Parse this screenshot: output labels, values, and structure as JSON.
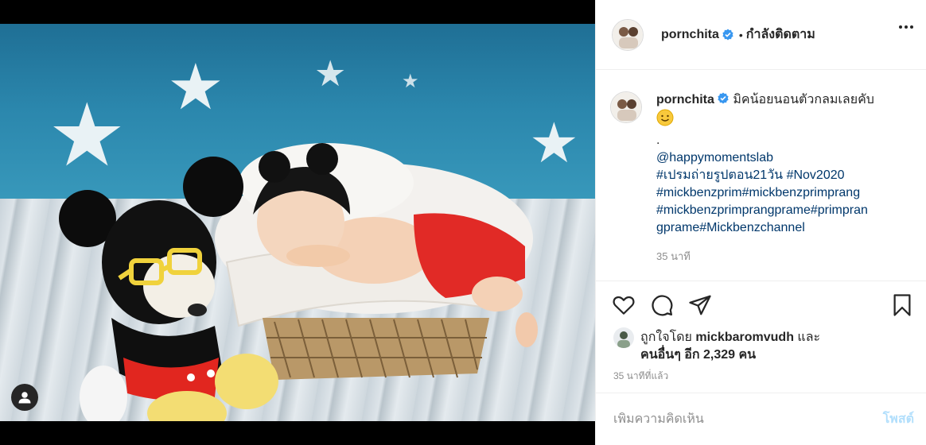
{
  "post": {
    "username": "pornchita",
    "follow_status": "กำลังติดตาม",
    "caption": {
      "username": "pornchita",
      "text": "มิคน้อยนอนตัวกลมเลยคับ",
      "emoji": "😊",
      "dot_line": ".",
      "mention": "@happymomentslab",
      "hashtag_line1": "#เปรมถ่ายรูปตอน21วัน #Nov2020",
      "hashtag_line2": "#mickbenzprim#mickbenzprimprang",
      "hashtag_line3": "#mickbenzprimprangprame#primpran",
      "hashtag_line4": "gprame#Mickbenzchannel",
      "time": "35 นาที"
    },
    "likes": {
      "prefix": "ถูกใจโดย",
      "user": "mickbaromvudh",
      "and": "และ",
      "others": "คนอื่นๆ อีก 2,329 คน"
    },
    "posted_time": "35 นาทีที่แล้ว",
    "comment_placeholder": "เพิ่มความคิดเห็น",
    "post_button": "โพสต์"
  },
  "icons": {
    "verified": "verified-badge-icon",
    "more": "more-options-icon",
    "like": "heart-icon",
    "comment": "comment-icon",
    "share": "share-icon",
    "save": "bookmark-icon",
    "user_tag": "user-tag-icon"
  },
  "colors": {
    "verified": "#3897f0",
    "link": "#00376b",
    "post_button": "#b2dffc",
    "muted": "#8e8e8e"
  }
}
